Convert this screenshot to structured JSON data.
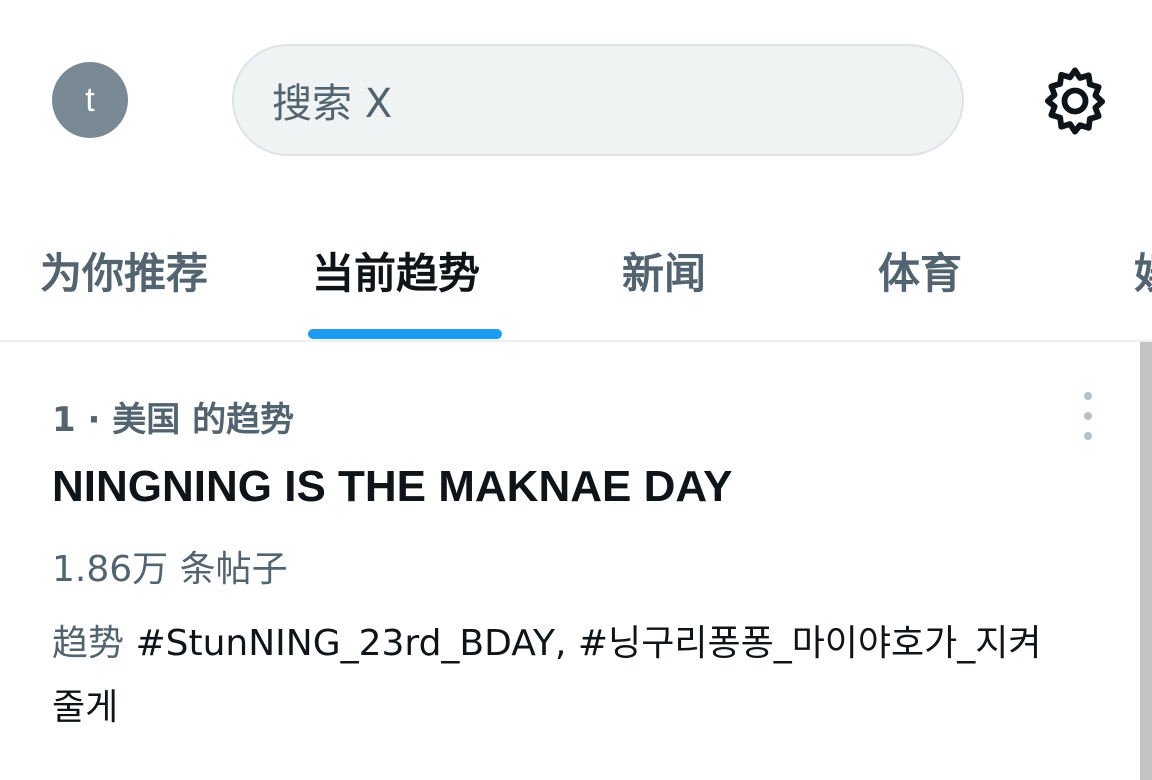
{
  "header": {
    "avatar_initial": "t",
    "search_placeholder": "搜索 X",
    "settings_icon": "gear-icon"
  },
  "tabs": [
    {
      "label": "为你推荐",
      "active": false
    },
    {
      "label": "当前趋势",
      "active": true
    },
    {
      "label": "新闻",
      "active": false
    },
    {
      "label": "体育",
      "active": false
    },
    {
      "label": "娱",
      "active": false
    }
  ],
  "accent_color": "#1d9bf0",
  "trend": {
    "meta": "1 · 美国 的趋势",
    "title": "NINGNING IS THE MAKNAE DAY",
    "post_count": "1.86万 条帖子",
    "tags_lead": "趋势",
    "tags": "#StunNING_23rd_BDAY, #닝구리퐁퐁_마이야호가_지켜줄게",
    "more_icon": "more-vertical-icon"
  }
}
